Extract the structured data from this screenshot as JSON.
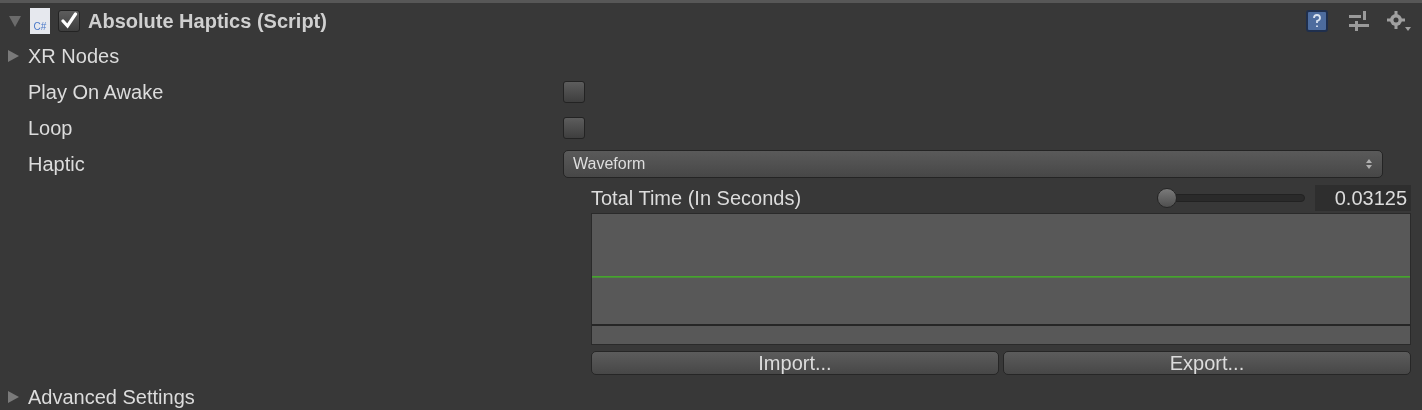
{
  "component": {
    "title": "Absolute Haptics (Script)",
    "expanded": true,
    "enabled": true,
    "script_icon": "C#"
  },
  "xr_nodes": {
    "label": "XR Nodes",
    "expanded": false
  },
  "fields": [
    {
      "kind": "checkbox",
      "label": "Play On Awake",
      "checked": false
    },
    {
      "kind": "checkbox",
      "label": "Loop",
      "checked": false
    },
    {
      "kind": "dropdown",
      "label": "Haptic",
      "value": "Waveform"
    }
  ],
  "total_time": {
    "label": "Total Time (In Seconds)",
    "level": 0.0,
    "value": "0.03125"
  },
  "buttons": [
    "Import...",
    "Export..."
  ],
  "advanced": {
    "label": "Advanced Settings",
    "expanded": false
  }
}
